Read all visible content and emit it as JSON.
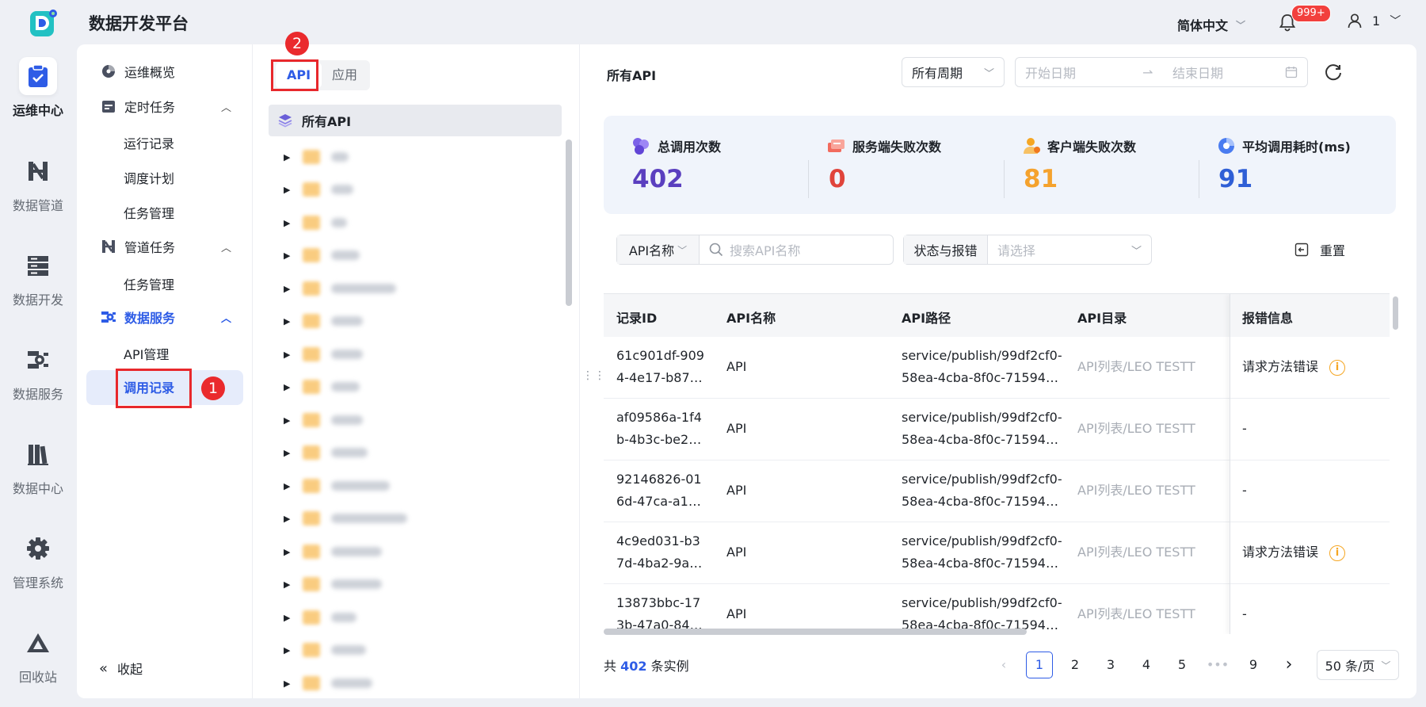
{
  "app": {
    "title": "数据开发平台",
    "language": "简体中文",
    "notifications": "999+",
    "user": "1"
  },
  "rail": [
    {
      "label": "运维中心",
      "icon": "clipboard-check-icon",
      "active": true
    },
    {
      "label": "数据管道",
      "icon": "pipeline-icon"
    },
    {
      "label": "数据开发",
      "icon": "server-stack-icon"
    },
    {
      "label": "数据服务",
      "icon": "service-icon"
    },
    {
      "label": "数据中心",
      "icon": "book-stack-icon"
    },
    {
      "label": "管理系统",
      "icon": "gear-icon"
    },
    {
      "label": "回收站",
      "icon": "recycle-icon"
    }
  ],
  "subnav": {
    "overview": "运维概览",
    "scheduled": {
      "label": "定时任务",
      "items": [
        "运行记录",
        "调度计划",
        "任务管理"
      ]
    },
    "pipeline": {
      "label": "管道任务",
      "items": [
        "任务管理"
      ]
    },
    "service": {
      "label": "数据服务",
      "items": [
        "API管理",
        "调用记录"
      ]
    },
    "collapse": "收起",
    "marker1": "1"
  },
  "tree": {
    "tabs": [
      "API",
      "应用"
    ],
    "marker2": "2",
    "root": "所有API"
  },
  "content": {
    "title": "所有API",
    "period": "所有周期",
    "start_placeholder": "开始日期",
    "end_placeholder": "结束日期",
    "stats": [
      {
        "label": "总调用次数",
        "value": "402",
        "color": "#5a3fbf"
      },
      {
        "label": "服务端失败次数",
        "value": "0",
        "color": "#e0443b"
      },
      {
        "label": "客户端失败次数",
        "value": "81",
        "color": "#f5a22d"
      },
      {
        "label": "平均调用耗时(ms)",
        "value": "91",
        "color": "#2f5fd6"
      }
    ],
    "filters": {
      "name_select": "API名称",
      "search_placeholder": "搜索API名称",
      "status_select": "状态与报错",
      "status_placeholder": "请选择",
      "reset": "重置"
    },
    "table": {
      "columns": [
        "记录ID",
        "API名称",
        "API路径",
        "API目录",
        "报错信息"
      ],
      "rows": [
        {
          "id1": "61c901df-909",
          "id2": "4-4e17-b87…",
          "name": "API",
          "path1": "service/publish/99df2cf0-",
          "path2": "58ea-4cba-8f0c-71594…",
          "dir": "API列表/LEO TESTT",
          "err": "请求方法错误"
        },
        {
          "id1": "af09586a-1f4",
          "id2": "b-4b3c-be2…",
          "name": "API",
          "path1": "service/publish/99df2cf0-",
          "path2": "58ea-4cba-8f0c-71594…",
          "dir": "API列表/LEO TESTT",
          "err": "-"
        },
        {
          "id1": "92146826-01",
          "id2": "6d-47ca-a1…",
          "name": "API",
          "path1": "service/publish/99df2cf0-",
          "path2": "58ea-4cba-8f0c-71594…",
          "dir": "API列表/LEO TESTT",
          "err": "-"
        },
        {
          "id1": "4c9ed031-b3",
          "id2": "7d-4ba2-9a…",
          "name": "API",
          "path1": "service/publish/99df2cf0-",
          "path2": "58ea-4cba-8f0c-71594…",
          "dir": "API列表/LEO TESTT",
          "err": "请求方法错误"
        },
        {
          "id1": "13873bbc-17",
          "id2": "3b-47a0-84…",
          "name": "API",
          "path1": "service/publish/99df2cf0-",
          "path2": "58ea-4cba-8f0c-71594…",
          "dir": "API列表/LEO TESTT",
          "err": "-"
        }
      ]
    },
    "pagination": {
      "prefix": "共",
      "total": "402",
      "suffix": "条实例",
      "pages": [
        "1",
        "2",
        "3",
        "4",
        "5",
        "•••",
        "9"
      ],
      "page_size": "50 条/页"
    }
  }
}
